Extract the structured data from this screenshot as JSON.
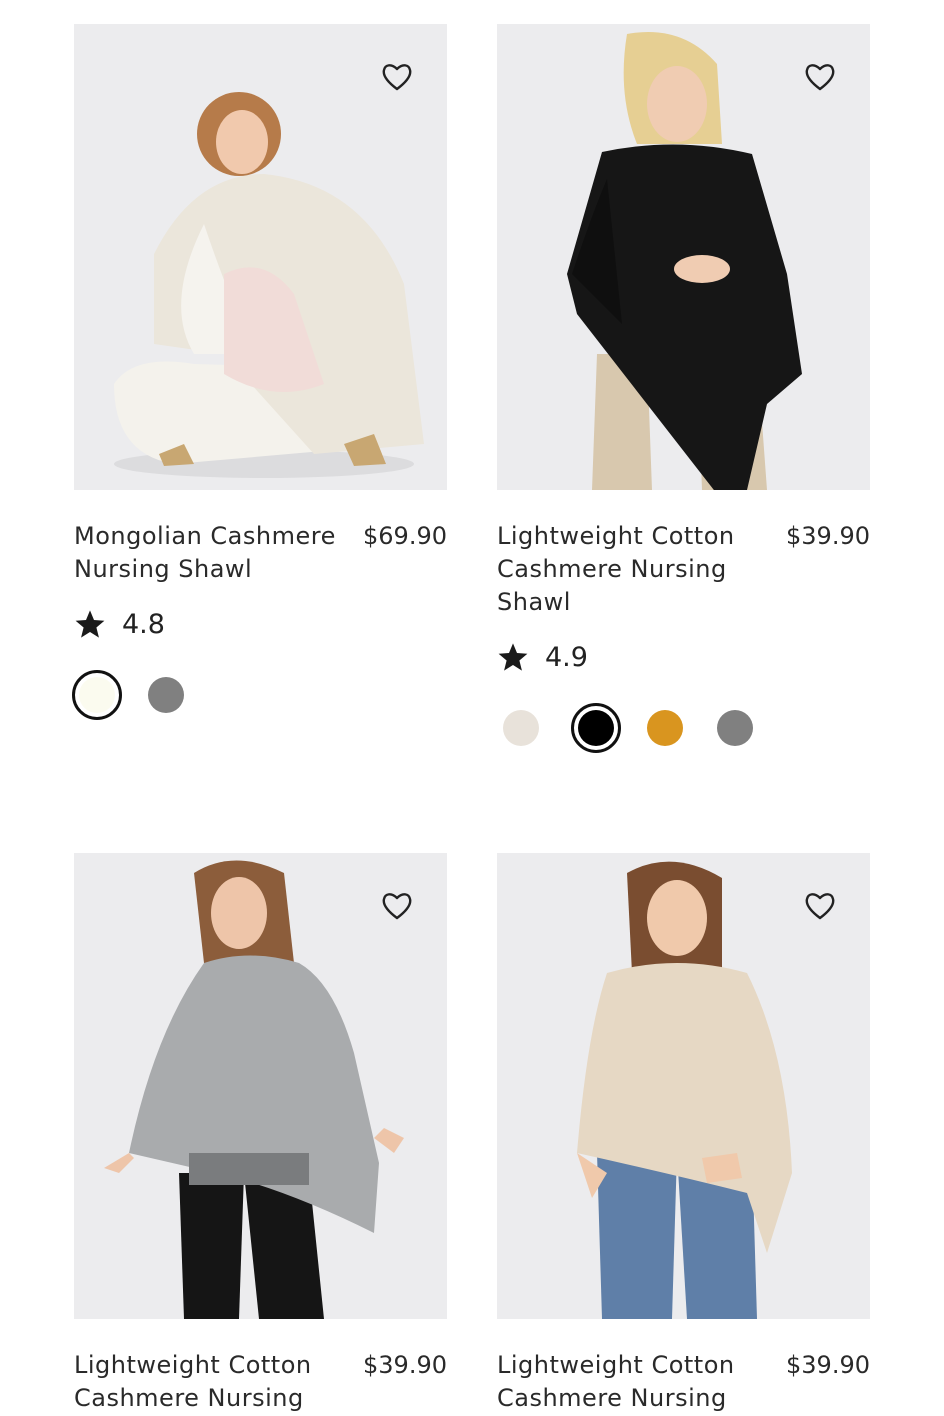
{
  "products": [
    {
      "title": "Mongolian Cashmere Nursing Shawl",
      "price": "$69.90",
      "rating": "4.8",
      "swatches": [
        "#fbfbef",
        "#808080"
      ],
      "selected_swatch": 0
    },
    {
      "title": "Lightweight Cotton Cashmere Nursing Shawl",
      "price": "$39.90",
      "rating": "4.9",
      "swatches": [
        "#e8e2da",
        "#000000",
        "#d9951f",
        "#808080"
      ],
      "selected_swatch": 1
    },
    {
      "title": "Lightweight Cotton Cashmere Nursing",
      "price": "$39.90"
    },
    {
      "title": "Lightweight Cotton Cashmere Nursing",
      "price": "$39.90"
    }
  ],
  "icons": {
    "favorite": "heart-icon",
    "rating": "star-icon"
  }
}
